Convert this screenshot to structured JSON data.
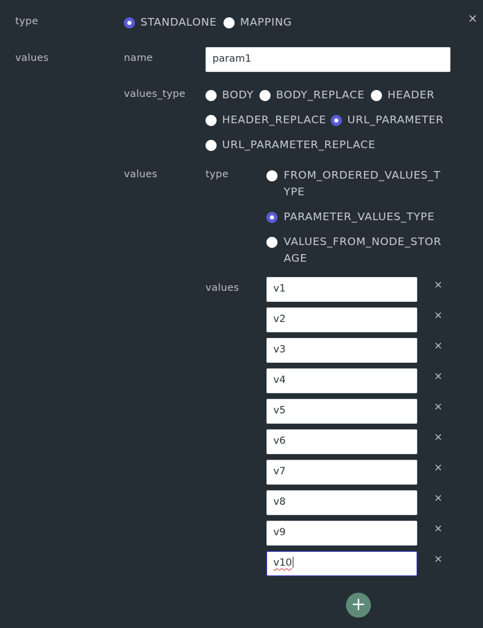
{
  "close_label": "×",
  "type_row": {
    "label": "type",
    "options": [
      {
        "label": "STANDALONE",
        "selected": true
      },
      {
        "label": "MAPPING",
        "selected": false
      }
    ]
  },
  "values_section": {
    "label": "values",
    "name": {
      "label": "name",
      "value": "param1"
    },
    "values_type": {
      "label": "values_type",
      "options": [
        {
          "label": "BODY",
          "selected": false
        },
        {
          "label": "BODY_REPLACE",
          "selected": false
        },
        {
          "label": "HEADER",
          "selected": false
        },
        {
          "label": "HEADER_REPLACE",
          "selected": false
        },
        {
          "label": "URL_PARAMETER",
          "selected": true
        },
        {
          "label": "URL_PARAMETER_REPLACE",
          "selected": false
        }
      ]
    },
    "values": {
      "label": "values",
      "type": {
        "label": "type",
        "options": [
          {
            "line1": "FROM_ORDERED_VALUES_T",
            "line2": "YPE",
            "selected": false
          },
          {
            "line1": "PARAMETER_VALUES_TYPE",
            "line2": "",
            "selected": true
          },
          {
            "line1": "VALUES_FROM_NODE_STOR",
            "line2": "AGE",
            "selected": false
          }
        ]
      },
      "values_label": "values",
      "items": [
        "v1",
        "v2",
        "v3",
        "v4",
        "v5",
        "v6",
        "v7",
        "v8",
        "v9",
        "v10"
      ],
      "remove_label": "×",
      "add_label": "+"
    }
  },
  "colors": {
    "background": "#252e35",
    "radio_selected": "#5a5cd6",
    "add_button": "#5e8a78",
    "focus_border": "#3c3fd0"
  }
}
